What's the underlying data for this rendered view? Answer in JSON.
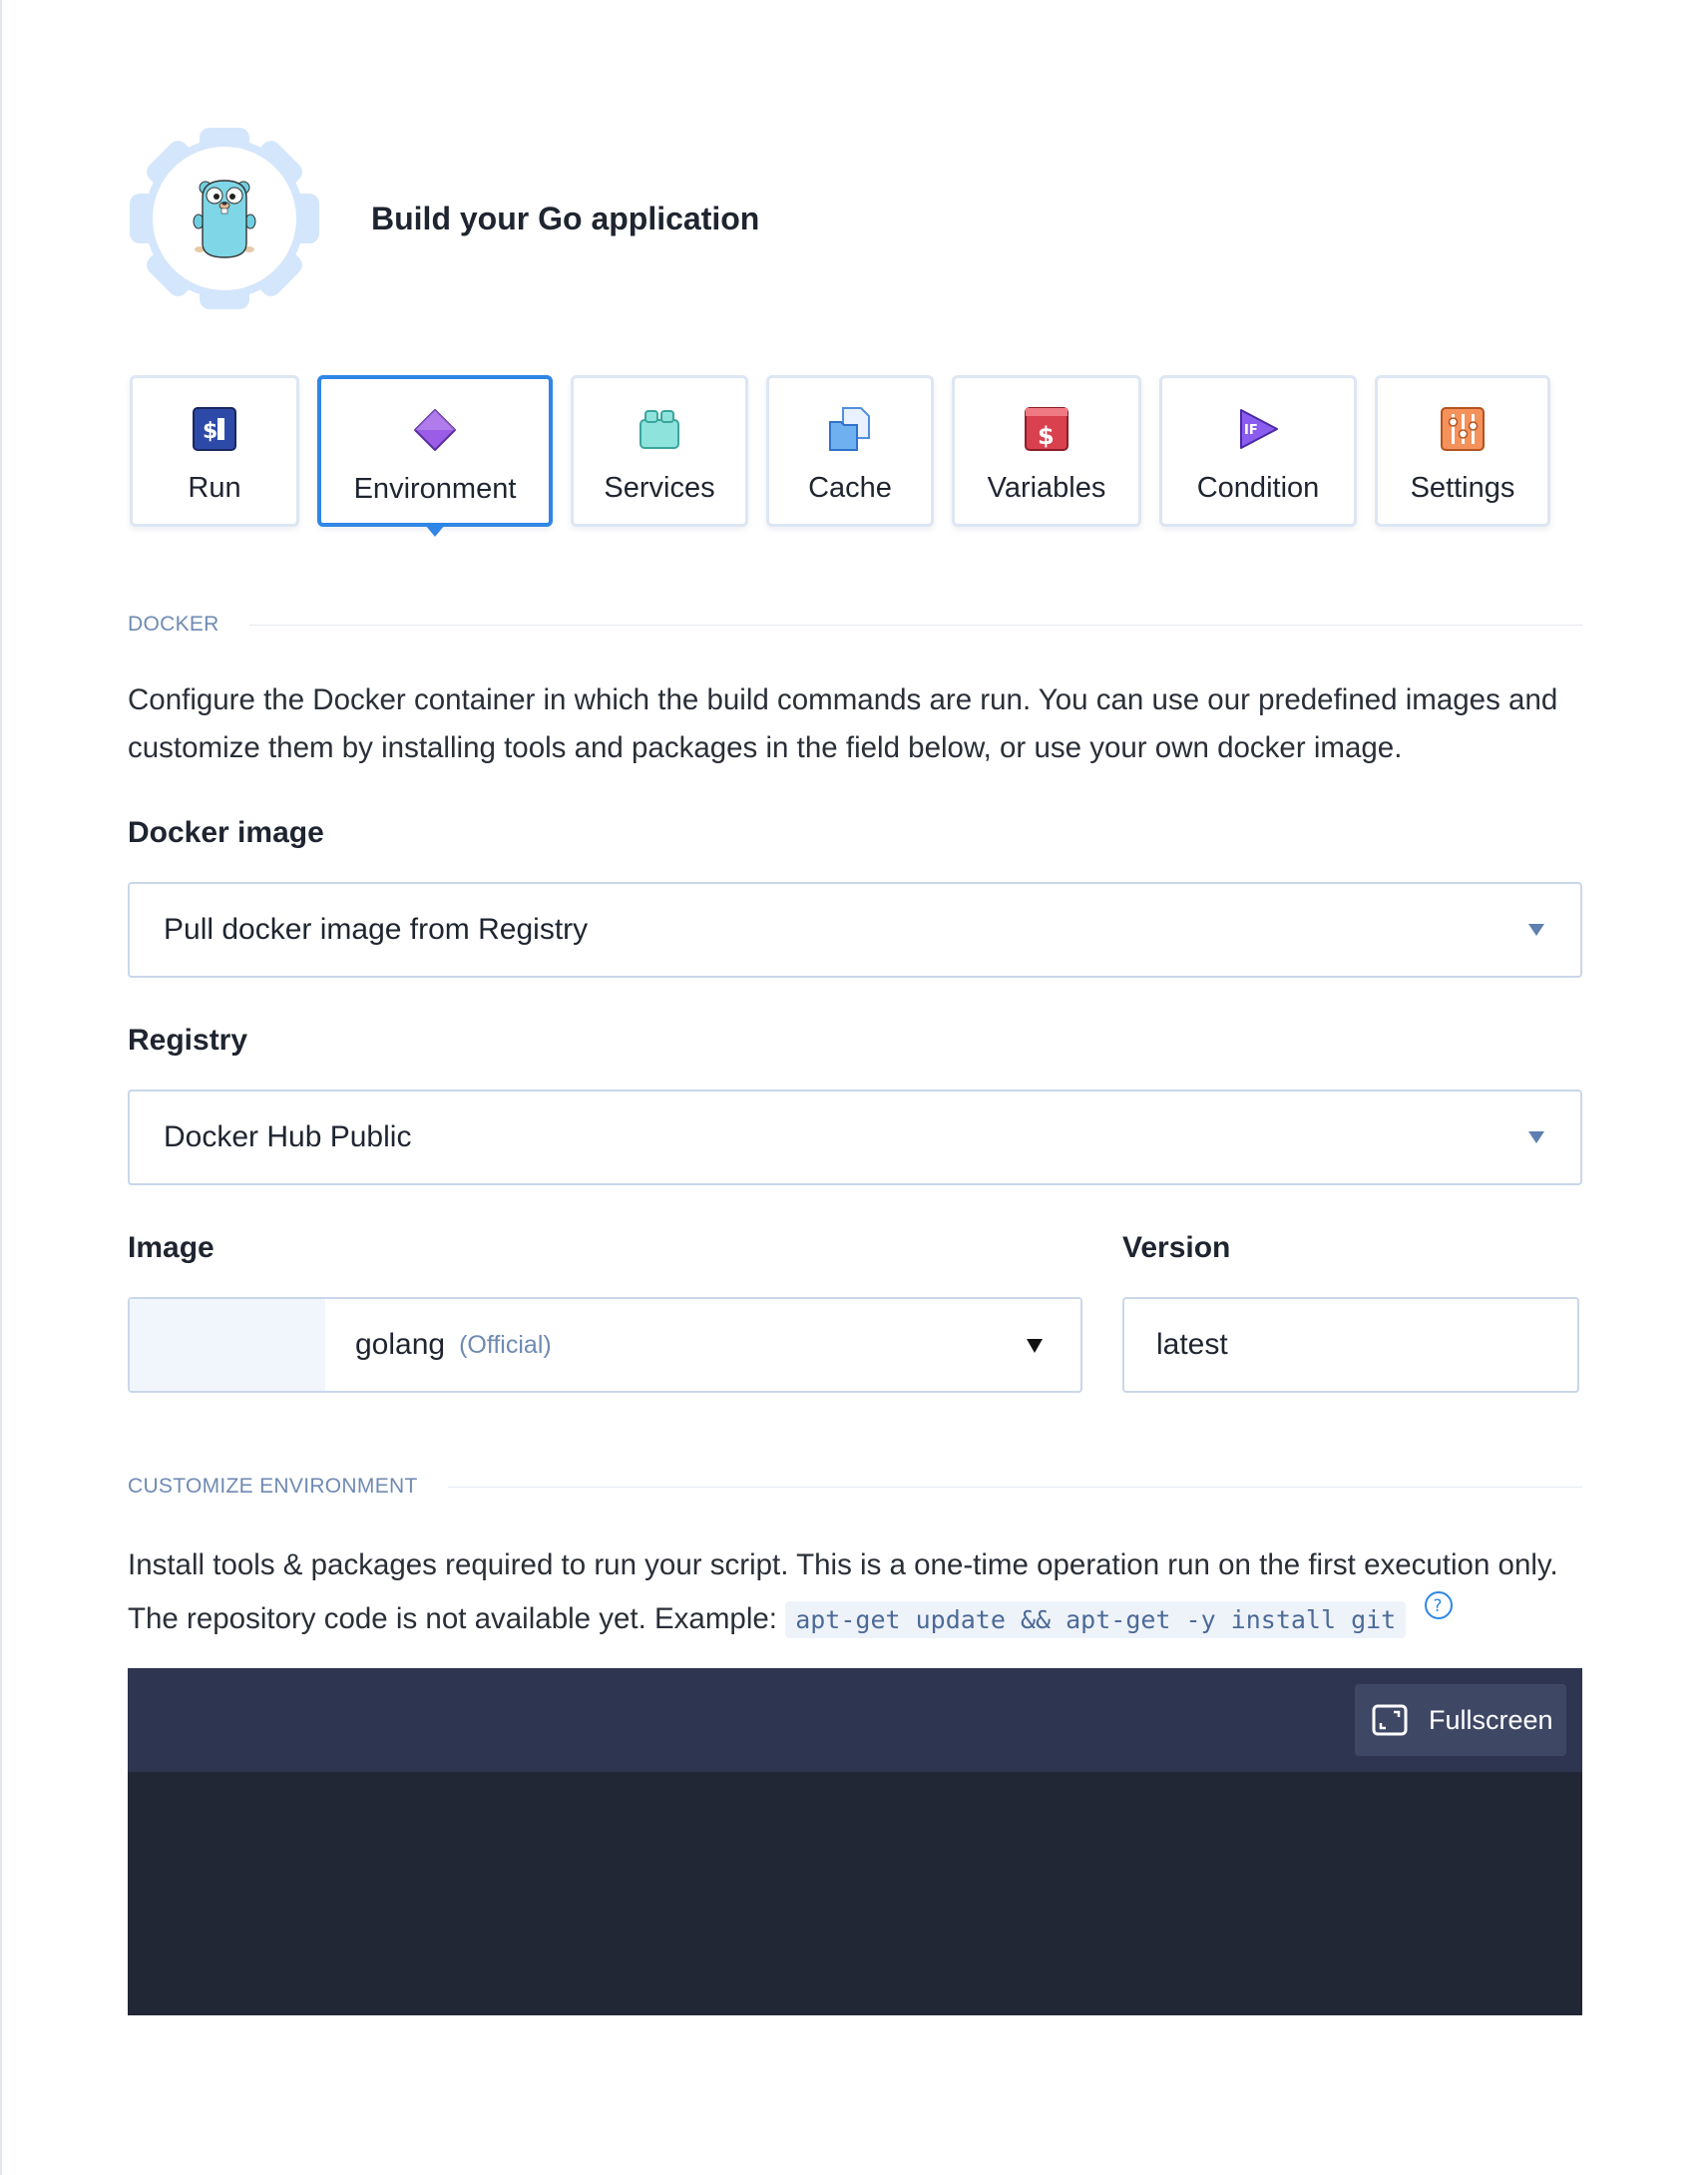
{
  "header": {
    "title": "Build your Go application"
  },
  "tabs": [
    {
      "label": "Run",
      "icon": "run-terminal-icon",
      "active": false
    },
    {
      "label": "Environment",
      "icon": "environment-diamond-icon",
      "active": true
    },
    {
      "label": "Services",
      "icon": "services-blocks-icon",
      "active": false
    },
    {
      "label": "Cache",
      "icon": "cache-files-icon",
      "active": false
    },
    {
      "label": "Variables",
      "icon": "variables-dollar-icon",
      "active": false
    },
    {
      "label": "Condition",
      "icon": "condition-if-icon",
      "active": false
    },
    {
      "label": "Settings",
      "icon": "settings-sliders-icon",
      "active": false
    }
  ],
  "docker": {
    "section_label": "DOCKER",
    "description": "Configure the Docker container in which the build commands are run. You can use our predefined images and customize them by installing tools and packages in the field below, or use your own docker image.",
    "docker_image_label": "Docker image",
    "docker_image_value": "Pull docker image from Registry",
    "registry_label": "Registry",
    "registry_value": "Docker Hub Public",
    "image_label": "Image",
    "image_value": "golang",
    "image_tag": "(Official)",
    "version_label": "Version",
    "version_value": "latest"
  },
  "customize": {
    "section_label": "CUSTOMIZE ENVIRONMENT",
    "description_line1": "Install tools & packages required to run your script. This is a one-time operation run on the first execution only.",
    "description_line2": "The repository code is not available yet. Example:",
    "example_code": "apt-get update && apt-get -y install git"
  },
  "editor": {
    "fullscreen_label": "Fullscreen"
  },
  "colors": {
    "accent": "#2f86e6",
    "editor_bg": "#212735",
    "editor_bar": "#2d3550"
  }
}
